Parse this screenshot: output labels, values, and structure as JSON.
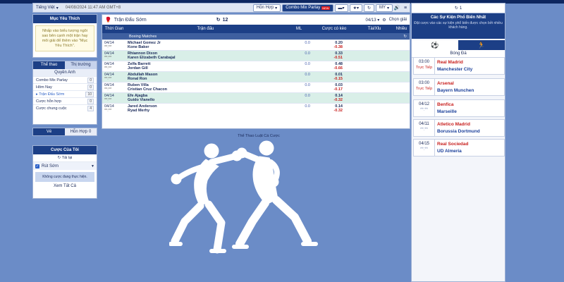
{
  "toolbar": {
    "language": "Tiếng Việt",
    "timestamp": "04/08/2024 11:47 AM GMT+8",
    "hon_hop": "Hỗn Hợp",
    "combo": "Combo Mix Parlay",
    "new_tag": "NEW",
    "my": "MY"
  },
  "favorites": {
    "title": "Mục Yêu Thích",
    "hint": "Nhấp vào biểu tượng ngôi sao bên cạnh một trận hay môi giải để thêm vào \"Mục Yêu Thích\"."
  },
  "sport_tabs": [
    "Thể thao",
    "Thị trường"
  ],
  "sport_panel": {
    "title": "Quyền Anh",
    "items": [
      {
        "label": "Combo Mix Parlay",
        "count": "0"
      },
      {
        "label": "Hôm Nay",
        "count": "0"
      },
      {
        "label": "▸ Trận Đấu Sớm",
        "count": "10"
      },
      {
        "label": "Cược hỗn hợp",
        "count": "0"
      },
      {
        "label": "Cược chung cuộc",
        "count": "4"
      }
    ]
  },
  "ve_tabs": {
    "ve": "Vé",
    "hon_hop": "Hỗn Hợp",
    "count": "0"
  },
  "my_bets": {
    "title": "Cược Của Tôi",
    "reload": "Tải lại",
    "cashout": "Rút Sớm",
    "no_bet": "Không cược đang thực hiện.",
    "see_all": "Xem Tất Cả"
  },
  "center": {
    "title": "Trận Đấu Sớm",
    "count": "12",
    "date_filter": "04/13",
    "choose_league": "Chọn giải",
    "columns": [
      "Thời Gian",
      "Trận đấu",
      "ML",
      "Cược có kèo",
      "Tài/Xỉu",
      "Nhiều"
    ],
    "section": "Boxing Matches",
    "matches": [
      {
        "date": "04/14",
        "live": "**:**",
        "home": "Michael Gomez Jr",
        "away": "Kone Baker",
        "ml": "0.0",
        "o1": "0.20",
        "o2": "-0.38"
      },
      {
        "date": "04/14",
        "live": "**:**",
        "home": "Rhiannon Dixon",
        "away": "Karen Elizabeth Carabajal",
        "ml": "0.0",
        "o1": "0.33",
        "o2": "-0.51"
      },
      {
        "date": "04/14",
        "live": "**:**",
        "home": "Zelfa Barrett",
        "away": "Jordan Gill",
        "ml": "0.0",
        "o1": "0.48",
        "o2": "-0.66"
      },
      {
        "date": "04/14",
        "live": "**:**",
        "home": "Abdullah Mason",
        "away": "Ronal Ron",
        "ml": "0.0",
        "o1": "0.01",
        "o2": "-0.15"
      },
      {
        "date": "04/14",
        "live": "**:**",
        "home": "Ruben Villa",
        "away": "Cristian Cruz Chacon",
        "ml": "0.0",
        "o1": "0.03",
        "o2": "-0.17"
      },
      {
        "date": "04/14",
        "live": "**:**",
        "home": "Efe Ajagba",
        "away": "Guido Vianello",
        "ml": "0.0",
        "o1": "0.14",
        "o2": "-0.32"
      },
      {
        "date": "04/14",
        "live": "**:**",
        "home": "Jared Anderson",
        "away": "Ryad Merhy",
        "ml": "0.0",
        "o1": "0.14",
        "o2": "-0.32"
      }
    ]
  },
  "promo_label": "Thể Thao Luật Cá Cược",
  "right": {
    "top_count": "1",
    "title": "Các Sự Kiện Phổ Biến Nhất",
    "subtitle": "Đặt cược vào các sự kiện phổ biến được chọn bởi nhiều khách hàng.",
    "category": "Bóng Đá",
    "events": [
      {
        "date": "03:00",
        "status": "Trực Tiếp",
        "home": "Real Madrid",
        "away": "Manchester City"
      },
      {
        "date": "03:00",
        "status": "Trực Tiếp",
        "home": "Arsenal",
        "away": "Bayern Munchen"
      },
      {
        "date": "04/12",
        "status": "**:**",
        "home": "Benfica",
        "away": "Marseille"
      },
      {
        "date": "04/11",
        "status": "**:**",
        "home": "Atletico Madrid",
        "away": "Borussia Dortmund"
      },
      {
        "date": "04/15",
        "status": "**:**",
        "home": "Real Sociedad",
        "away": "UD Almeria"
      }
    ]
  },
  "colors": {
    "brand": "#1c3f86",
    "background": "#6b8cc7",
    "negative": "#c8201e",
    "alt_row": "#d9efe8"
  }
}
